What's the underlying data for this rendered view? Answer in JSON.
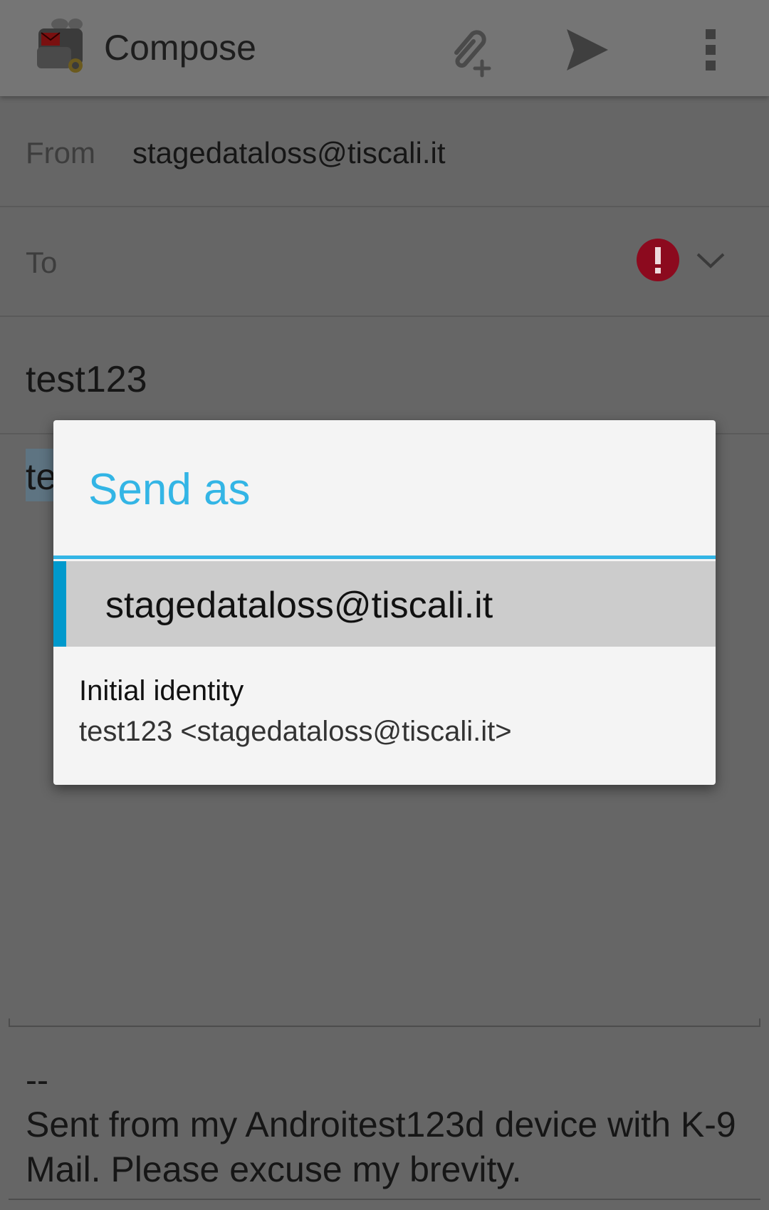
{
  "actionbar": {
    "title": "Compose",
    "icons": [
      "app-icon",
      "attach-icon",
      "send-icon",
      "overflow-menu-icon"
    ]
  },
  "from": {
    "label": "From",
    "value": "stagedataloss@tiscali.it"
  },
  "to": {
    "label": "To",
    "value": "",
    "status_icon": "error-icon",
    "expand_icon": "chevron-down-icon"
  },
  "subject": {
    "value": "test123"
  },
  "body": {
    "visible_fragment": "te"
  },
  "signature": {
    "dash": "--",
    "text": "Sent from my Androitest123d device with K-9 Mail. Please excuse my brevity."
  },
  "dialog": {
    "title": "Send as",
    "account": "stagedataloss@tiscali.it",
    "identities": [
      {
        "name": "Initial identity",
        "address": "test123 <stagedataloss@tiscali.it>"
      }
    ]
  },
  "colors": {
    "accent": "#33b5e5",
    "selection_marker": "#0099cc",
    "error": "#b00020",
    "scrim": "#666666"
  }
}
